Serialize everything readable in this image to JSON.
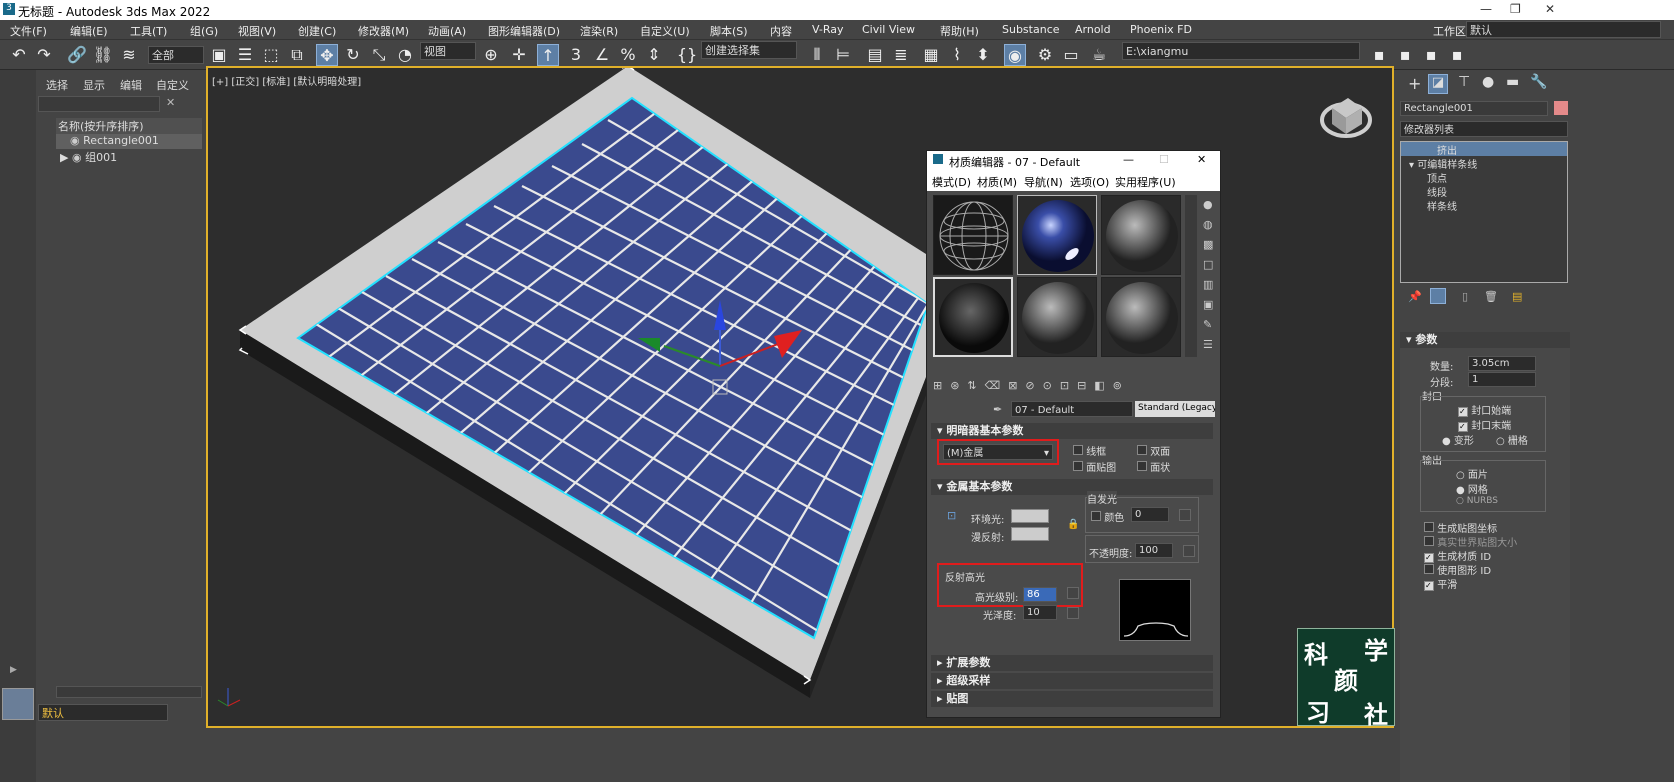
{
  "window": {
    "title": "无标题 - Autodesk 3ds Max 2022",
    "workspace_label": "工作区:",
    "workspace_value": "默认"
  },
  "menu": [
    "文件(F)",
    "编辑(E)",
    "工具(T)",
    "组(G)",
    "视图(V)",
    "创建(C)",
    "修改器(M)",
    "动画(A)",
    "图形编辑器(D)",
    "渲染(R)",
    "自定义(U)",
    "脚本(S)",
    "内容",
    "V-Ray",
    "Civil View",
    "帮助(H)",
    "Substance",
    "Arnold",
    "Phoenix FD"
  ],
  "toolbar": {
    "filter": "全部",
    "view": "视图",
    "selset": "创建选择集",
    "path": "E:\\xiangmu"
  },
  "scene_explorer": {
    "tabs": [
      "选择",
      "显示",
      "编辑",
      "自定义"
    ],
    "header": "名称(按升序排序)",
    "items": [
      "Rectangle001",
      "组001"
    ],
    "layer": "默认"
  },
  "viewport": {
    "label": "[+] [正交] [标准] [默认明暗处理]"
  },
  "command_panel": {
    "object_name": "Rectangle001",
    "modifier_list": "修改器列表",
    "stack": [
      "挤出",
      "可编辑样条线",
      "顶点",
      "线段",
      "样条线"
    ],
    "params_title": "参数",
    "amount_label": "数量:",
    "amount_value": "3.05cm",
    "segments_label": "分段:",
    "segments_value": "1",
    "capping_title": "封口",
    "cap_start": "封口始端",
    "cap_end": "封口末端",
    "morph": "变形",
    "grid": "栅格",
    "output_title": "输出",
    "patch": "面片",
    "mesh": "网格",
    "nurbs": "NURBS",
    "gen_map": "生成贴图坐标",
    "real_world": "真实世界贴图大小",
    "gen_mat": "生成材质 ID",
    "use_shape": "使用图形 ID",
    "smooth": "平滑"
  },
  "material_editor": {
    "title": "材质编辑器 - 07 - Default",
    "menus": [
      "模式(D)",
      "材质(M)",
      "导航(N)",
      "选项(O)",
      "实用程序(U)"
    ],
    "mat_name": "07 - Default",
    "mat_type": "Standard (Legacy)",
    "shader_section": "明暗器基本参数",
    "shader_value": "(M)金属",
    "wire": "线框",
    "two_sided": "双面",
    "face_map": "面贴图",
    "faceted": "面状",
    "metal_section": "金属基本参数",
    "ambient": "环境光:",
    "diffuse": "漫反射:",
    "self_illum": "自发光",
    "color": "颜色",
    "color_value": "0",
    "opacity": "不透明度:",
    "opacity_value": "100",
    "spec_title": "反射高光",
    "spec_level": "高光级别:",
    "spec_level_value": "86",
    "gloss": "光泽度:",
    "gloss_value": "10",
    "rollouts": [
      "扩展参数",
      "超级采样",
      "贴图"
    ]
  },
  "watermark": {
    "chars": [
      "科",
      "学",
      "颜",
      "习",
      "社"
    ]
  },
  "colors": {
    "accent": "#e0b02a",
    "selection": "#5d7fa5",
    "highlight_red": "#e01c1c",
    "plane_blue": "#3a4a8e"
  }
}
